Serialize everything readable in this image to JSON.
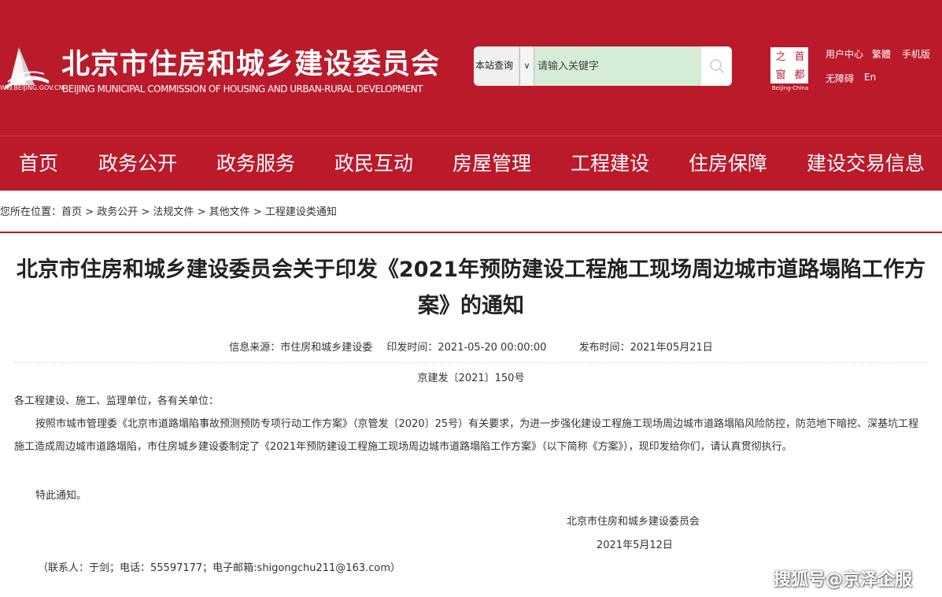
{
  "header": {
    "site_title": "北京市住房和城乡建设委员会",
    "site_subtitle": "BEIJING MUNICIPAL COMMISSION OF HOUSING AND URBAN-RURAL DEVELOPMENT",
    "logo_url_text": "WW.BEIJING.GOV.CN",
    "search": {
      "scope_label": "本站查询",
      "placeholder": "请输入关键字"
    },
    "seal": {
      "chars": [
        "之",
        "首",
        "窗",
        "都"
      ],
      "caption": "Beijing-China"
    },
    "tools": {
      "user_center": "用户中心",
      "traditional": "繁體",
      "mobile": "手机版",
      "accessible": "无障碍",
      "english": "En"
    },
    "colors": {
      "brand_red": "#bb1a2b",
      "search_bg": "#d5ecd7"
    }
  },
  "nav": {
    "items": [
      "首页",
      "政务公开",
      "政务服务",
      "政民互动",
      "房屋管理",
      "工程建设",
      "住房保障",
      "建设交易信息"
    ]
  },
  "breadcrumb": {
    "prefix": "您所在位置：",
    "items": [
      "首页",
      "政务公开",
      "法规文件",
      "其他文件",
      "工程建设类通知"
    ],
    "separator": ">"
  },
  "article": {
    "title_line1": "北京市住房和城乡建设委员会关于印发《2021年预防建设工程施工现场周边城市道路塌陷工作方",
    "title_line2": "案》的通知",
    "meta": {
      "source": "信息来源：市住房和城乡建设委",
      "print_time": "印发时间：2021-05-20 00:00:00",
      "publish_time": "发布时间：2021年05月21日"
    },
    "doc_number": "京建发〔2021〕150号",
    "salutation": "各工程建设、施工、监理单位，各有关单位：",
    "body": "按照市城市管理委《北京市道路塌陷事故预测预防专项行动工作方案》（京管发〔2020〕25号）有关要求，为进一步强化建设工程施工现场周边城市道路塌陷风险防控，防范地下暗挖、深基坑工程施工造成周边城市道路塌陷，市住房城乡建设委制定了《2021年预防建设工程施工现场周边城市道路塌陷工作方案》（以下简称《方案》），现印发给你们，请认真贯彻执行。",
    "closing": "特此通知。",
    "signature_org": "北京市住房和城乡建设委员会",
    "signature_date": "2021年5月12日",
    "contact": "（联系人：于剑；电话：55597177；电子邮箱:shigongchu211@163.com）"
  },
  "watermark": "搜狐号@京泽企服"
}
